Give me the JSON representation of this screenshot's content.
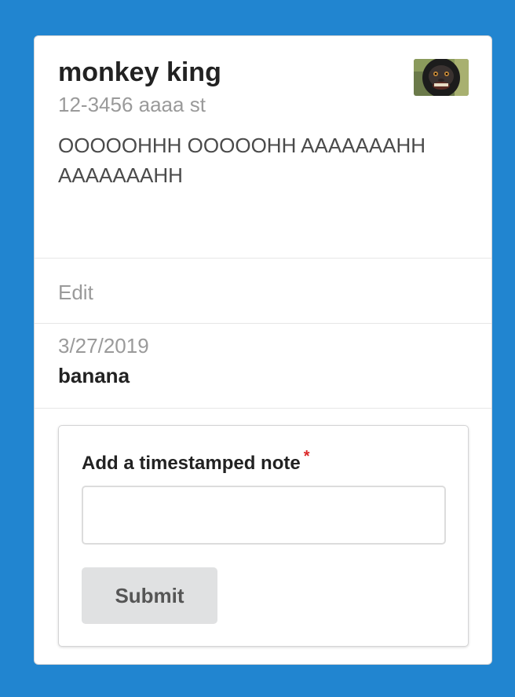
{
  "card": {
    "header": "monkey king",
    "meta": "12-3456 aaaa st",
    "description": "OOOOOHHH OOOOOHH AAAAAAAHH AAAAAAAHH",
    "edit_label": "Edit",
    "avatar_alt": "monkey-face"
  },
  "note": {
    "date": "3/27/2019",
    "text": "banana"
  },
  "form": {
    "label": "Add a timestamped note",
    "required_marker": "*",
    "input_value": "",
    "submit_label": "Submit"
  },
  "colors": {
    "background": "#2185d0",
    "card": "#ffffff",
    "required": "#db2828",
    "button": "#e0e1e2"
  }
}
